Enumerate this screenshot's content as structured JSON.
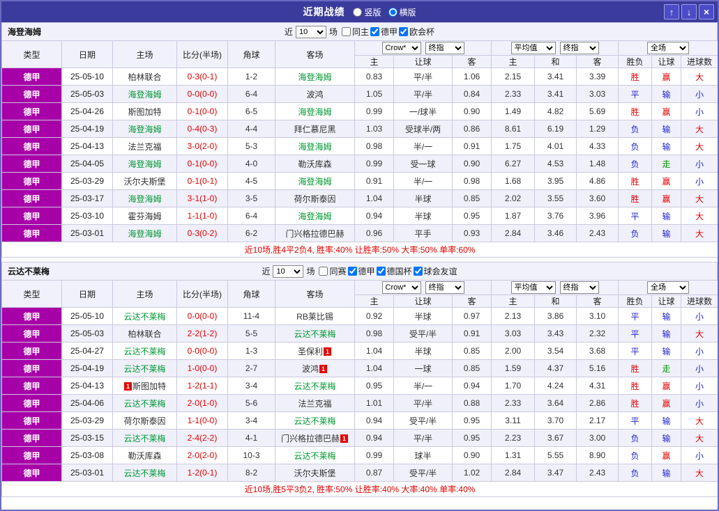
{
  "titlebar": {
    "title": "近期战绩",
    "radios": [
      {
        "label": "竖版",
        "checked": false
      },
      {
        "label": "横版",
        "checked": true
      }
    ],
    "up_icon": "↑",
    "down_icon": "↓",
    "close_icon": "×"
  },
  "labels": {
    "near": "近",
    "games": "场"
  },
  "columns": {
    "type": "类型",
    "date": "日期",
    "home": "主场",
    "score": "比分(半场)",
    "corner": "角球",
    "away": "客场",
    "odds1_source": "Crow*",
    "odds1_time": "终指",
    "odds2_source": "平均值",
    "odds2_time": "终指",
    "result_scope": "全场",
    "o1_home": "主",
    "o1_hcap": "让球",
    "o1_away": "客",
    "o2_home": "主",
    "o2_draw": "和",
    "o2_away": "客",
    "r_wdl": "胜负",
    "r_hcap": "让球",
    "r_goals": "进球数"
  },
  "colors": {
    "titlebar_bg": "#3b3b9d",
    "league_bg": "#a800a8",
    "red": "#e60000",
    "blue": "#2222cc",
    "green": "#009900",
    "highlight_team": "#009933",
    "result_map": {
      "胜": "#e60000",
      "赢": "#e60000",
      "大": "#e60000",
      "走": "#009900",
      "平": "#2222cc",
      "负": "#2222cc",
      "输": "#2222cc",
      "小": "#2222cc"
    }
  },
  "sections": [
    {
      "team": "海登海姆",
      "filter": {
        "count": "10",
        "checks": [
          {
            "label": "同主",
            "checked": false
          },
          {
            "label": "德甲",
            "checked": true
          },
          {
            "label": "欧会杯",
            "checked": true
          }
        ]
      },
      "rows": [
        {
          "league": "德甲",
          "date": "25-05-10",
          "home": {
            "name": "柏林联合"
          },
          "score": "0-3(0-1)",
          "corner": "1-2",
          "away": {
            "name": "海登海姆",
            "hl": true
          },
          "o1": [
            "0.83",
            "平/半",
            "1.06"
          ],
          "o2": [
            "2.15",
            "3.41",
            "3.39"
          ],
          "res": [
            "胜",
            "赢",
            "大"
          ]
        },
        {
          "league": "德甲",
          "date": "25-05-03",
          "home": {
            "name": "海登海姆",
            "hl": true
          },
          "score": "0-0(0-0)",
          "corner": "6-4",
          "away": {
            "name": "波鸿"
          },
          "o1": [
            "1.05",
            "平/半",
            "0.84"
          ],
          "o2": [
            "2.33",
            "3.41",
            "3.03"
          ],
          "res": [
            "平",
            "输",
            "小"
          ]
        },
        {
          "league": "德甲",
          "date": "25-04-26",
          "home": {
            "name": "斯图加特"
          },
          "score": "0-1(0-0)",
          "corner": "6-5",
          "away": {
            "name": "海登海姆",
            "hl": true
          },
          "o1": [
            "0.99",
            "一/球半",
            "0.90"
          ],
          "o2": [
            "1.49",
            "4.82",
            "5.69"
          ],
          "res": [
            "胜",
            "赢",
            "小"
          ]
        },
        {
          "league": "德甲",
          "date": "25-04-19",
          "home": {
            "name": "海登海姆",
            "hl": true
          },
          "score": "0-4(0-3)",
          "corner": "4-4",
          "away": {
            "name": "拜仁慕尼黑"
          },
          "o1": [
            "1.03",
            "受球半/两",
            "0.86"
          ],
          "o2": [
            "8.61",
            "6.19",
            "1.29"
          ],
          "res": [
            "负",
            "输",
            "大"
          ]
        },
        {
          "league": "德甲",
          "date": "25-04-13",
          "home": {
            "name": "法兰克福"
          },
          "score": "3-0(2-0)",
          "corner": "5-3",
          "away": {
            "name": "海登海姆",
            "hl": true
          },
          "o1": [
            "0.98",
            "半/一",
            "0.91"
          ],
          "o2": [
            "1.75",
            "4.01",
            "4.33"
          ],
          "res": [
            "负",
            "输",
            "大"
          ]
        },
        {
          "league": "德甲",
          "date": "25-04-05",
          "home": {
            "name": "海登海姆",
            "hl": true
          },
          "score": "0-1(0-0)",
          "corner": "4-0",
          "away": {
            "name": "勒沃库森"
          },
          "o1": [
            "0.99",
            "受一球",
            "0.90"
          ],
          "o2": [
            "6.27",
            "4.53",
            "1.48"
          ],
          "res": [
            "负",
            "走",
            "小"
          ]
        },
        {
          "league": "德甲",
          "date": "25-03-29",
          "home": {
            "name": "沃尔夫斯堡"
          },
          "score": "0-1(0-1)",
          "corner": "4-5",
          "away": {
            "name": "海登海姆",
            "hl": true
          },
          "o1": [
            "0.91",
            "半/一",
            "0.98"
          ],
          "o2": [
            "1.68",
            "3.95",
            "4.86"
          ],
          "res": [
            "胜",
            "赢",
            "小"
          ]
        },
        {
          "league": "德甲",
          "date": "25-03-17",
          "home": {
            "name": "海登海姆",
            "hl": true
          },
          "score": "3-1(1-0)",
          "corner": "3-5",
          "away": {
            "name": "荷尔斯泰因"
          },
          "o1": [
            "1.04",
            "半球",
            "0.85"
          ],
          "o2": [
            "2.02",
            "3.55",
            "3.60"
          ],
          "res": [
            "胜",
            "赢",
            "大"
          ]
        },
        {
          "league": "德甲",
          "date": "25-03-10",
          "home": {
            "name": "霍芬海姆"
          },
          "score": "1-1(1-0)",
          "corner": "6-4",
          "away": {
            "name": "海登海姆",
            "hl": true
          },
          "o1": [
            "0.94",
            "半球",
            "0.95"
          ],
          "o2": [
            "1.87",
            "3.76",
            "3.96"
          ],
          "res": [
            "平",
            "输",
            "大"
          ]
        },
        {
          "league": "德甲",
          "date": "25-03-01",
          "home": {
            "name": "海登海姆",
            "hl": true
          },
          "score": "0-3(0-2)",
          "corner": "6-2",
          "away": {
            "name": "门兴格拉德巴赫"
          },
          "o1": [
            "0.96",
            "平手",
            "0.93"
          ],
          "o2": [
            "2.84",
            "3.46",
            "2.43"
          ],
          "res": [
            "负",
            "输",
            "大"
          ]
        }
      ],
      "summary": "近10场,胜4平2负4, 胜率:40%  让胜率:50%  大率:50%  单率:60%"
    },
    {
      "team": "云达不莱梅",
      "filter": {
        "count": "10",
        "checks": [
          {
            "label": "同赛",
            "checked": false
          },
          {
            "label": "德甲",
            "checked": true
          },
          {
            "label": "德国杯",
            "checked": true
          },
          {
            "label": "球会友谊",
            "checked": true
          }
        ]
      },
      "rows": [
        {
          "league": "德甲",
          "date": "25-05-10",
          "home": {
            "name": "云达不莱梅",
            "hl": true
          },
          "score": "0-0(0-0)",
          "corner": "11-4",
          "away": {
            "name": "RB莱比锡"
          },
          "o1": [
            "0.92",
            "半球",
            "0.97"
          ],
          "o2": [
            "2.13",
            "3.86",
            "3.10"
          ],
          "res": [
            "平",
            "输",
            "小"
          ]
        },
        {
          "league": "德甲",
          "date": "25-05-03",
          "home": {
            "name": "柏林联合"
          },
          "score": "2-2(1-2)",
          "corner": "5-5",
          "away": {
            "name": "云达不莱梅",
            "hl": true
          },
          "o1": [
            "0.98",
            "受平/半",
            "0.91"
          ],
          "o2": [
            "3.03",
            "3.43",
            "2.32"
          ],
          "res": [
            "平",
            "输",
            "大"
          ]
        },
        {
          "league": "德甲",
          "date": "25-04-27",
          "home": {
            "name": "云达不莱梅",
            "hl": true
          },
          "score": "0-0(0-0)",
          "corner": "1-3",
          "away": {
            "name": "圣保利",
            "card": "1"
          },
          "o1": [
            "1.04",
            "半球",
            "0.85"
          ],
          "o2": [
            "2.00",
            "3.54",
            "3.68"
          ],
          "res": [
            "平",
            "输",
            "小"
          ]
        },
        {
          "league": "德甲",
          "date": "25-04-19",
          "home": {
            "name": "云达不莱梅",
            "hl": true
          },
          "score": "1-0(0-0)",
          "corner": "2-7",
          "away": {
            "name": "波鸿",
            "card": "1"
          },
          "o1": [
            "1.04",
            "一球",
            "0.85"
          ],
          "o2": [
            "1.59",
            "4.37",
            "5.16"
          ],
          "res": [
            "胜",
            "走",
            "小"
          ]
        },
        {
          "league": "德甲",
          "date": "25-04-13",
          "home": {
            "name": "斯图加特",
            "card": "1",
            "card_pos": "before"
          },
          "score": "1-2(1-1)",
          "corner": "3-4",
          "away": {
            "name": "云达不莱梅",
            "hl": true
          },
          "o1": [
            "0.95",
            "半/一",
            "0.94"
          ],
          "o2": [
            "1.70",
            "4.24",
            "4.31"
          ],
          "res": [
            "胜",
            "赢",
            "小"
          ]
        },
        {
          "league": "德甲",
          "date": "25-04-06",
          "home": {
            "name": "云达不莱梅",
            "hl": true
          },
          "score": "2-0(1-0)",
          "corner": "5-6",
          "away": {
            "name": "法兰克福"
          },
          "o1": [
            "1.01",
            "平/半",
            "0.88"
          ],
          "o2": [
            "2.33",
            "3.64",
            "2.86"
          ],
          "res": [
            "胜",
            "赢",
            "小"
          ]
        },
        {
          "league": "德甲",
          "date": "25-03-29",
          "home": {
            "name": "荷尔斯泰因"
          },
          "score": "1-1(0-0)",
          "corner": "3-4",
          "away": {
            "name": "云达不莱梅",
            "hl": true
          },
          "o1": [
            "0.94",
            "受平/半",
            "0.95"
          ],
          "o2": [
            "3.11",
            "3.70",
            "2.17"
          ],
          "res": [
            "平",
            "输",
            "大"
          ]
        },
        {
          "league": "德甲",
          "date": "25-03-15",
          "home": {
            "name": "云达不莱梅",
            "hl": true
          },
          "score": "2-4(2-2)",
          "corner": "4-1",
          "away": {
            "name": "门兴格拉德巴赫",
            "card": "1"
          },
          "o1": [
            "0.94",
            "平/半",
            "0.95"
          ],
          "o2": [
            "2.23",
            "3.67",
            "3.00"
          ],
          "res": [
            "负",
            "输",
            "大"
          ]
        },
        {
          "league": "德甲",
          "date": "25-03-08",
          "home": {
            "name": "勒沃库森"
          },
          "score": "2-0(2-0)",
          "corner": "10-3",
          "away": {
            "name": "云达不莱梅",
            "hl": true
          },
          "o1": [
            "0.99",
            "球半",
            "0.90"
          ],
          "o2": [
            "1.31",
            "5.55",
            "8.90"
          ],
          "res": [
            "负",
            "赢",
            "小"
          ]
        },
        {
          "league": "德甲",
          "date": "25-03-01",
          "home": {
            "name": "云达不莱梅",
            "hl": true
          },
          "score": "1-2(0-1)",
          "corner": "8-2",
          "away": {
            "name": "沃尔夫斯堡"
          },
          "o1": [
            "0.87",
            "受平/半",
            "1.02"
          ],
          "o2": [
            "2.84",
            "3.47",
            "2.43"
          ],
          "res": [
            "负",
            "输",
            "大"
          ]
        }
      ],
      "summary": "近10场,胜5平3负2, 胜率:50%  让胜率:40%  大率:40%  单率:40%"
    }
  ]
}
